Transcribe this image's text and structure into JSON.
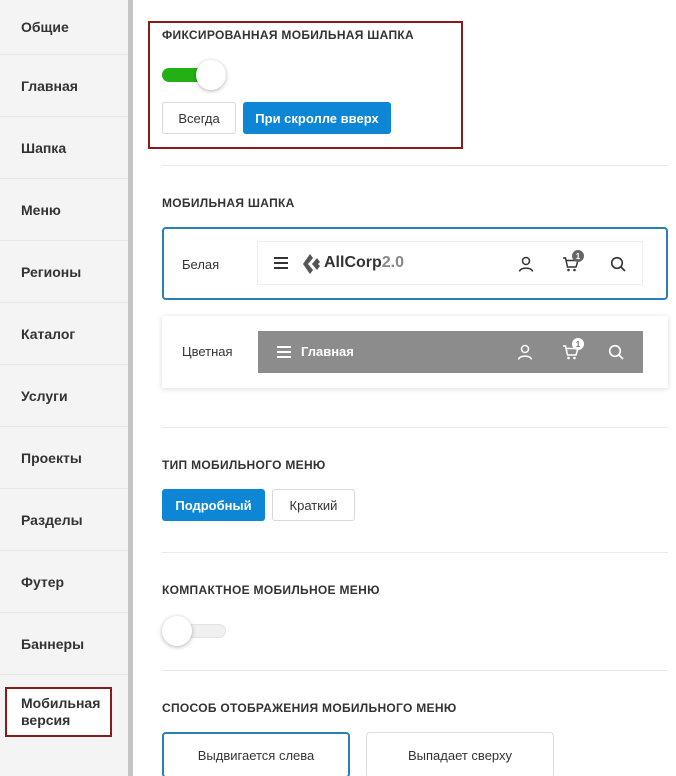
{
  "sidebar": {
    "items": [
      {
        "label": "Общие"
      },
      {
        "label": "Главная"
      },
      {
        "label": "Шапка"
      },
      {
        "label": "Меню"
      },
      {
        "label": "Регионы"
      },
      {
        "label": "Каталог"
      },
      {
        "label": "Услуги"
      },
      {
        "label": "Проекты"
      },
      {
        "label": "Разделы"
      },
      {
        "label": "Футер"
      },
      {
        "label": "Баннеры"
      }
    ],
    "active_label_1": "Мобильная",
    "active_label_2": "версия"
  },
  "fixed_header": {
    "title": "ФИКСИРОВАННАЯ МОБИЛЬНАЯ ШАПКА",
    "toggle_on": true,
    "always_label": "Всегда",
    "on_scroll_label": "При скролле вверх"
  },
  "mobile_header": {
    "title": "МОБИЛЬНАЯ ШАПКА",
    "white_label": "Белая",
    "colored_label": "Цветная",
    "logo_text": "AllCorp",
    "logo_version": "2.0",
    "colored_title": "Главная",
    "cart_count": "1"
  },
  "menu_type": {
    "title": "ТИП МОБИЛЬНОГО МЕНЮ",
    "detailed_label": "Подробный",
    "short_label": "Краткий"
  },
  "compact_menu": {
    "title": "КОМПАКТНОЕ МОБИЛЬНОЕ МЕНЮ",
    "toggle_on": false
  },
  "menu_display": {
    "title": "СПОСОБ ОТОБРАЖЕНИЯ МОБИЛЬНОГО МЕНЮ",
    "slide_left_label": "Выдвигается слева",
    "drop_top_label": "Выпадает сверху"
  },
  "colors": {
    "accent": "#0d86d6",
    "toggle_on": "#22b014",
    "highlight": "#8b1a1a",
    "colored_header_bg": "#8c8c8c"
  }
}
